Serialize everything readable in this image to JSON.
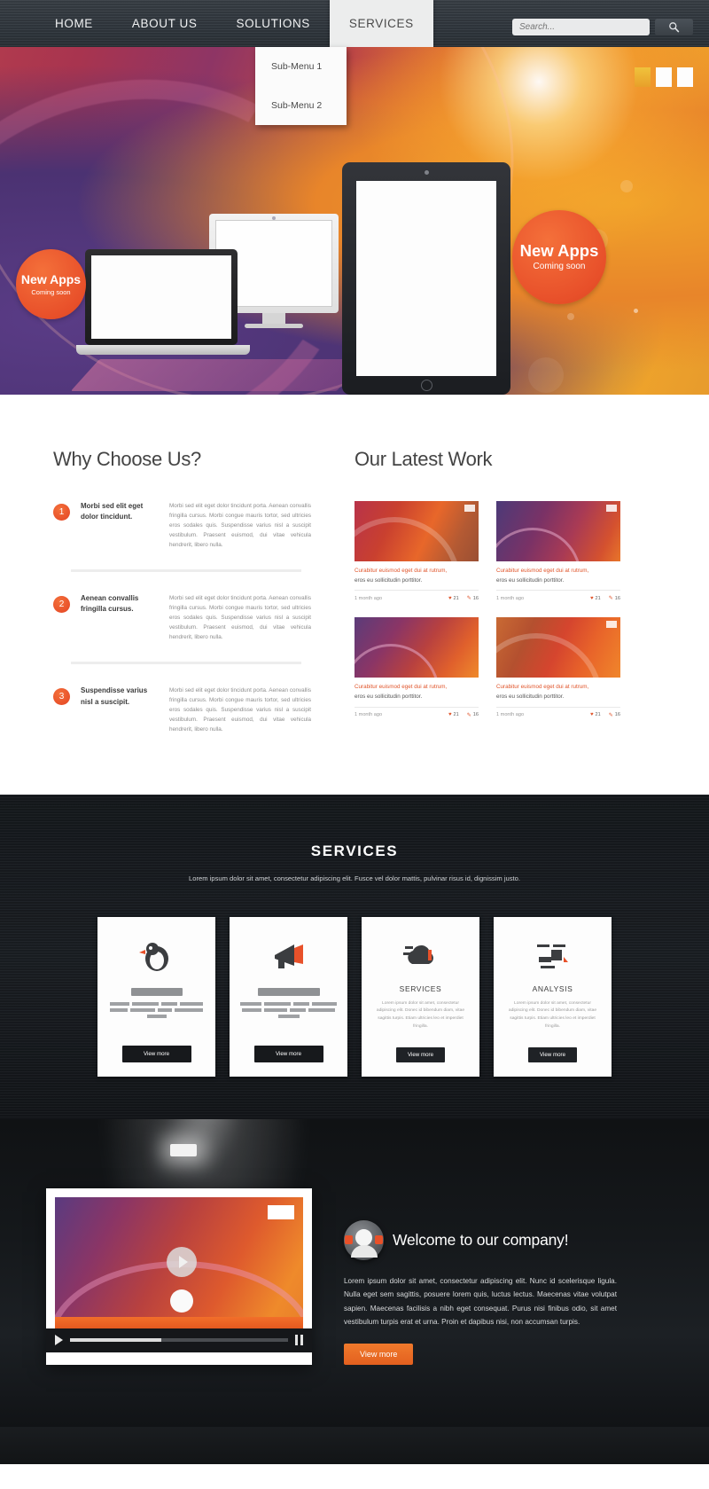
{
  "nav": {
    "items": [
      {
        "label": "HOME",
        "active": false
      },
      {
        "label": "ABOUT US",
        "active": false
      },
      {
        "label": "SOLUTIONS",
        "active": false
      },
      {
        "label": "SERVICES",
        "active": true
      }
    ],
    "submenu": [
      "Sub-Menu 1",
      "Sub-Menu 2"
    ],
    "search_placeholder": "Search...",
    "search_value": "",
    "search_icon": "search-icon"
  },
  "hero": {
    "badge_left": {
      "title": "New Apps",
      "subtitle": "Coming soon"
    },
    "badge_right": {
      "title": "New Apps",
      "subtitle": "Coming soon"
    },
    "slider_dots": 3,
    "active_dot": 0,
    "accent": "#e8502a"
  },
  "why": {
    "title": "Why Choose Us?",
    "items": [
      {
        "number": "1",
        "heading": "Morbi sed elit eget dolor tincidunt.",
        "body": "Morbi sed elit eget dolor tincidunt porta. Aenean convallis fringilla cursus. Morbi congue mauris tortor, sed ultricies eros sodales quis. Suspendisse varius nisl a suscipit vestibulum. Praesent euismod, dui vitae vehicula hendrerit, libero nulla."
      },
      {
        "number": "2",
        "heading": "Aenean convallis fringilla cursus.",
        "body": "Morbi sed elit eget dolor tincidunt porta. Aenean convallis fringilla cursus. Morbi congue mauris tortor, sed ultricies eros sodales quis. Suspendisse varius nisl a suscipit vestibulum. Praesent euismod, dui vitae vehicula hendrerit, libero nulla."
      },
      {
        "number": "3",
        "heading": "Suspendisse varius nisl a suscipit.",
        "body": "Morbi sed elit eget dolor tincidunt porta. Aenean convallis fringilla cursus. Morbi congue mauris tortor, sed ultricies eros sodales quis. Suspendisse varius nisl a suscipit vestibulum. Praesent euismod, dui vitae vehicula hendrerit, libero nulla."
      }
    ]
  },
  "work": {
    "title": "Our Latest Work",
    "items": [
      {
        "caption_line1": "Curabitur euismod eget dui at rutrum,",
        "caption_line2": "eros eu sollicitudin porttitor.",
        "time": "1 month ago",
        "likes": "21",
        "comments": "16"
      },
      {
        "caption_line1": "Curabitur euismod eget dui at rutrum,",
        "caption_line2": "eros eu sollicitudin porttitor.",
        "time": "1 month ago",
        "likes": "21",
        "comments": "16"
      },
      {
        "caption_line1": "Curabitur euismod eget dui at rutrum,",
        "caption_line2": "eros eu sollicitudin porttitor.",
        "time": "1 month ago",
        "likes": "21",
        "comments": "16"
      },
      {
        "caption_line1": "Curabitur euismod eget dui at rutrum,",
        "caption_line2": "eros eu sollicitudin porttitor.",
        "time": "1 month ago",
        "likes": "21",
        "comments": "16"
      }
    ]
  },
  "services": {
    "title": "SERVICES",
    "subtitle": "Lorem ipsum dolor sit amet, consectetur adipiscing elit. Fusce vel dolor mattis, pulvinar risus id, dignissim justo.",
    "cards": [
      {
        "icon": "bird-icon",
        "title": "",
        "text": "",
        "button": "View more",
        "show_text": false
      },
      {
        "icon": "megaphone-icon",
        "title": "",
        "text": "",
        "button": "View more",
        "show_text": false
      },
      {
        "icon": "cloud-upload-icon",
        "title": "SERVICES",
        "text": "Lorem ipsum dolor sit amet, consectetur adipiscing elit. Donec id bibendum diam, vitae sagittis turpis. Etiam ultricies leo et imperdiet fringilla.",
        "button": "View more",
        "show_text": true
      },
      {
        "icon": "chart-icon",
        "title": "ANALYSIS",
        "text": "Lorem ipsum dolor sit amet, consectetur adipiscing elit. Donec id bibendum diam, vitae sagittis turpis. Etiam ultricies leo et imperdiet fringilla.",
        "button": "View more",
        "show_text": true
      }
    ]
  },
  "welcome": {
    "title": "Welcome to our company!",
    "body": "Lorem ipsum dolor sit amet, consectetur adipiscing elit. Nunc id scelerisque ligula. Nulla eget sem sagittis, posuere lorem quis, luctus lectus. Maecenas vitae volutpat sapien. Maecenas facilisis a nibh eget consequat. Purus nisi finibus odio, sit amet vestibulum turpis erat et urna. Proin et dapibus nisi, non accumsan turpis.",
    "button": "View more",
    "avatar": "user-avatar-icon",
    "player": {
      "play_icon": "play-icon",
      "pause_icon": "pause-icon",
      "progress": "42"
    }
  }
}
